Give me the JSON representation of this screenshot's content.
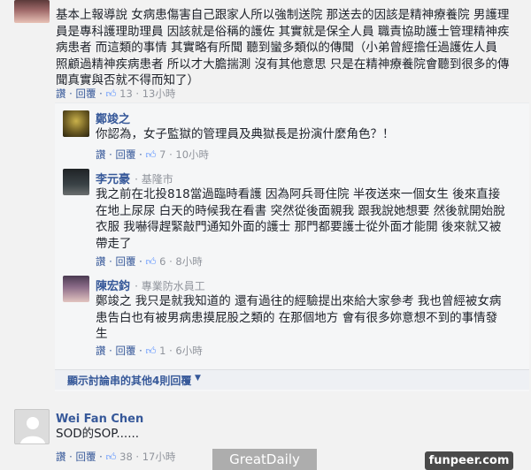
{
  "comments": [
    {
      "text": "基本上報導說 女病患傷害自己跟家人所以強制送院 那送去的因該是精神療養院 男護理員是專科護理助理員 因該就是俗稱的護佐 其實就是保全人員 職責協助護士管理精神疾病患者 而這類的事情 其實略有所聞 聽到蠻多類似的傳聞（小弟曾經擔任過護佐人員照顧過精神疾病患者 所以才大膽揣測 沒有其他意思 只是在精神療養院會聽到很多的傳聞真實與否就不得而知了）",
      "lines": [
        "基本上報導說 女病患傷害自己跟家人所以強制送院 那送去的因該是精神療養院 男護理",
        "員是專科護理助理員 因該就是俗稱的護佐 其實就是保全人員 職責協助護士管理精神疾",
        "病患者 而這類的事情 其實略有所聞 聽到蠻多類似的傳聞（小弟曾經擔任過護佐人員",
        "照顧過精神疾病患者 所以才大膽揣測 沒有其他意思 只是在精神療養院會聽到很多的傳",
        "聞真實與否就不得而知了）"
      ],
      "reply_label": "讚 · 回覆 ·",
      "likes": "13",
      "time": "13小時"
    },
    {
      "author": "鄭竣之",
      "lines": [
        "你認為，女子監獄的管理員及典獄長是扮演什麼角色？！"
      ],
      "reply_label": "讚 · 回覆 ·",
      "likes": "7",
      "time": "10小時"
    },
    {
      "author": "李元豪",
      "subtitle": "· 基隆市",
      "lines": [
        "我之前在北投818當過臨時看護 因為阿兵哥住院 半夜送來一個女生 後來直接",
        "在地上尿尿 白天的時候我在看書 突然從後面親我 跟我說她想要 然後就開始脫",
        "衣服 我嚇得趕緊敲門通知外面的護士 那門都要護士從外面才能開 後來就又被",
        "帶走了"
      ],
      "reply_label": "讚 · 回覆 ·",
      "likes": "6",
      "time": "8小時"
    },
    {
      "author": "陳宏鈞",
      "subtitle": "· 專業防水員工",
      "lines": [
        "鄭竣之 我只是就我知道的 還有過往的經驗提出來給大家參考 我也曾經被女病",
        "患告白也有被男病患摸屁股之類的 在那個地方 會有很多妳意想不到的事情發",
        "生"
      ],
      "reply_label": "讚 · 回覆 ·",
      "likes": "1",
      "time": "6小時"
    },
    {
      "author": "Wei Fan Chen",
      "lines": [
        "SOD的SOP......"
      ],
      "reply_label": "讚 · 回覆 ·",
      "likes": "38",
      "time": "17小時"
    }
  ],
  "more_replies": "顯示討論串的其他4則回覆",
  "watermark_left": "GreatDaily",
  "watermark_right": "funpeer.com",
  "colors": {
    "link": "#365899",
    "meta": "#90949c",
    "like": "#5890ff"
  }
}
